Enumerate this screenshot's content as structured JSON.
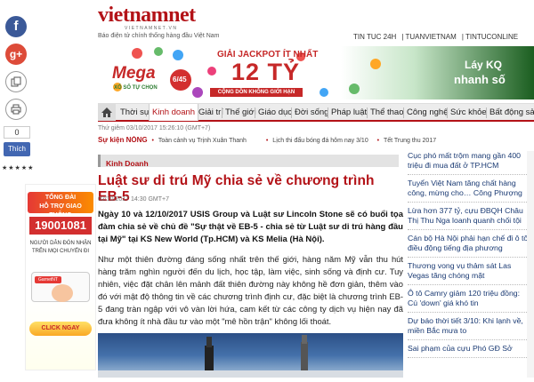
{
  "social": {
    "facebook_glyph": "f",
    "gplus_glyph": "g+",
    "count": "0",
    "like_label": "Thích"
  },
  "left_ad": {
    "line1": "TỔNG ĐÀI",
    "line2": "HỖ TRỢ GIAO THÔNG",
    "hotline": "19001081",
    "line3": "NGƯỜI DÂN ĐÓN NHẬN",
    "line4": "TRÊN MỌI CHUYẾN ĐI",
    "brand": "GarnetNT",
    "cta": "CLICK NGAY"
  },
  "header": {
    "logo_text": "vietnamnet",
    "logo_sub": "VIETNAMNET.VN",
    "tagline": "Báo điện tử chính thống hàng đầu Việt Nam",
    "links": [
      "TIN TUC 24H",
      "TUANVIETNAM",
      "TINTUCONLINE"
    ]
  },
  "banner": {
    "brand": "Mega",
    "brand_num": "6/45",
    "brand_sub": "XỔ SỐ TỰ CHỌN",
    "headline": "GIẢI JACKPOT ÍT NHẤT",
    "amount": "12 TỶ",
    "subline": "CỘNG DỒN KHÔNG GIỚI HẠN",
    "right_text1": "Láy KQ",
    "right_text2": "nhanh số"
  },
  "nav": {
    "items": [
      "Thời sự",
      "Kinh doanh",
      "Giải trí",
      "Thế giới",
      "Giáo dục",
      "Đời sống",
      "Pháp luật",
      "Thể thao",
      "Công nghệ",
      "Sức khỏe",
      "Bất động sản"
    ],
    "active": "Kinh doanh"
  },
  "date_line": "Thứ giêm 03/10/2017 15:26:10 (GMT+7)",
  "hot": {
    "label": "Sự kiện NÓNG",
    "items": [
      "Toàn cảnh vụ Trịnh Xuân Thanh",
      "Lịch thi đấu bóng đá hôm nay 3/10",
      "Tết Trung thu 2017"
    ]
  },
  "article": {
    "category": "Kinh Doanh",
    "title": "Luật sư di trú Mỹ chia sẻ về chương trình EB-5",
    "date": "02/10/2017  14:30 GMT+7",
    "lead": "Ngày 10 và 12/10/2017 USIS Group và Luật sư Lincoln Stone sẽ có buổi tọa đàm chia sẻ về chủ đề \"Sự thật về EB-5 - chia sẻ từ Luật sư di trú hàng đầu tại Mỹ\" tại KS New World (Tp.HCM) và KS Melia (Hà Nội).",
    "body": "Như một thiên đường đáng sống nhất trên thế giới, hàng năm Mỹ vẫn thu hút hàng trăm nghìn người đến du lịch, học tập, làm việc, sinh sống và định cư. Tuy nhiên, việc đặt chân lên mảnh đất thiên đường này không hề đơn giản, thêm vào đó với mật độ thông tin về các chương trình định cư, đặc biệt là chương trình EB-5 đang tràn ngập với vô vàn lời hứa, cam kết từ các công ty dịch vụ hiện nay đã đưa không ít nhà đầu tư vào một \"mê hồn trận\" không lối thoát."
  },
  "right_list": [
    "Cục phó mất trộm mang gần 400 triệu đi mua đất ở TP.HCM",
    "Tuyển Việt Nam tăng chất hàng công, mừng cho… Công Phượng",
    "Lừa hơn 377 tỷ, cựu ĐBQH Châu Thị Thu Nga loanh quanh chối tội",
    "Cán bộ Hà Nội phải hạn chế đi ô tô, điều động tiếng địa phương",
    "Thương vong vụ thảm sát Las Vegas tăng chóng mặt",
    "Ô tô Camry giảm 120 triệu đồng: Cú 'down' giá khó tin",
    "Dự báo thời tiết 3/10: Khi lạnh về, miền Bắc mưa to",
    "Sai phạm của cựu Phó GĐ Sở"
  ]
}
